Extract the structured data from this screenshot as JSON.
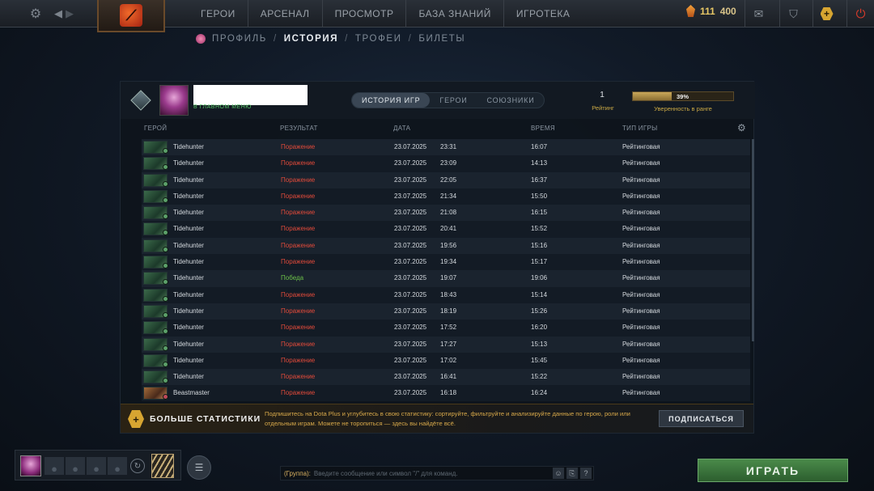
{
  "nav": {
    "items": [
      "ГЕРОИ",
      "АРСЕНАЛ",
      "ПРОСМОТР",
      "БАЗА ЗНАНИЙ",
      "ИГРОТЕКА"
    ],
    "currency_shards": "111",
    "currency_gold": "400"
  },
  "subnav": {
    "items": [
      "ПРОФИЛЬ",
      "ИСТОРИЯ",
      "ТРОФЕИ",
      "БИЛЕТЫ"
    ],
    "active": "ИСТОРИЯ"
  },
  "profile": {
    "main_menu_link": "В ГЛАВНОМ МЕНЮ",
    "rating_value": "1",
    "rating_label": "Рейтинг",
    "confidence_percent": 39,
    "confidence_text": "39%",
    "confidence_label": "Уверенность в ранге"
  },
  "tabs": [
    "ИСТОРИЯ ИГР",
    "ГЕРОИ",
    "СОЮЗНИКИ"
  ],
  "columns": [
    "ГЕРОЙ",
    "РЕЗУЛЬТАТ",
    "ДАТА",
    "ВРЕМЯ",
    "ТИП ИГРЫ"
  ],
  "matches": [
    {
      "hero": "Tidehunter",
      "result": "Поражение",
      "win": false,
      "date": "23.07.2025",
      "time": "23:31",
      "duration": "16:07",
      "type": "Рейтинговая"
    },
    {
      "hero": "Tidehunter",
      "result": "Поражение",
      "win": false,
      "date": "23.07.2025",
      "time": "23:09",
      "duration": "14:13",
      "type": "Рейтинговая"
    },
    {
      "hero": "Tidehunter",
      "result": "Поражение",
      "win": false,
      "date": "23.07.2025",
      "time": "22:05",
      "duration": "16:37",
      "type": "Рейтинговая"
    },
    {
      "hero": "Tidehunter",
      "result": "Поражение",
      "win": false,
      "date": "23.07.2025",
      "time": "21:34",
      "duration": "15:50",
      "type": "Рейтинговая"
    },
    {
      "hero": "Tidehunter",
      "result": "Поражение",
      "win": false,
      "date": "23.07.2025",
      "time": "21:08",
      "duration": "16:15",
      "type": "Рейтинговая"
    },
    {
      "hero": "Tidehunter",
      "result": "Поражение",
      "win": false,
      "date": "23.07.2025",
      "time": "20:41",
      "duration": "15:52",
      "type": "Рейтинговая"
    },
    {
      "hero": "Tidehunter",
      "result": "Поражение",
      "win": false,
      "date": "23.07.2025",
      "time": "19:56",
      "duration": "15:16",
      "type": "Рейтинговая"
    },
    {
      "hero": "Tidehunter",
      "result": "Поражение",
      "win": false,
      "date": "23.07.2025",
      "time": "19:34",
      "duration": "15:17",
      "type": "Рейтинговая"
    },
    {
      "hero": "Tidehunter",
      "result": "Победа",
      "win": true,
      "date": "23.07.2025",
      "time": "19:07",
      "duration": "19:06",
      "type": "Рейтинговая"
    },
    {
      "hero": "Tidehunter",
      "result": "Поражение",
      "win": false,
      "date": "23.07.2025",
      "time": "18:43",
      "duration": "15:14",
      "type": "Рейтинговая"
    },
    {
      "hero": "Tidehunter",
      "result": "Поражение",
      "win": false,
      "date": "23.07.2025",
      "time": "18:19",
      "duration": "15:26",
      "type": "Рейтинговая"
    },
    {
      "hero": "Tidehunter",
      "result": "Поражение",
      "win": false,
      "date": "23.07.2025",
      "time": "17:52",
      "duration": "16:20",
      "type": "Рейтинговая"
    },
    {
      "hero": "Tidehunter",
      "result": "Поражение",
      "win": false,
      "date": "23.07.2025",
      "time": "17:27",
      "duration": "15:13",
      "type": "Рейтинговая"
    },
    {
      "hero": "Tidehunter",
      "result": "Поражение",
      "win": false,
      "date": "23.07.2025",
      "time": "17:02",
      "duration": "15:45",
      "type": "Рейтинговая"
    },
    {
      "hero": "Tidehunter",
      "result": "Поражение",
      "win": false,
      "date": "23.07.2025",
      "time": "16:41",
      "duration": "15:22",
      "type": "Рейтинговая"
    },
    {
      "hero": "Beastmaster",
      "result": "Поражение",
      "win": false,
      "date": "23.07.2025",
      "time": "16:18",
      "duration": "16:24",
      "type": "Рейтинговая"
    }
  ],
  "promo": {
    "title": "БОЛЬШЕ СТАТИСТИКИ",
    "text": "Подпишитесь на Dota Plus и углубитесь в свою статистику: сортируйте, фильтруйте и анализируйте данные по герою, роли или отдельным играм. Можете не торопиться — здесь вы найдёте всё.",
    "button": "ПОДПИСАТЬСЯ"
  },
  "chat": {
    "channel": "(Группа):",
    "placeholder": "Введите сообщение или символ \"/\" для команд."
  },
  "play_button": "ИГРАТЬ",
  "colors": {
    "loss": "#e04a3a",
    "win": "#6cc048",
    "accent_gold": "#d7a531",
    "play_green": "#3a7a3c"
  }
}
